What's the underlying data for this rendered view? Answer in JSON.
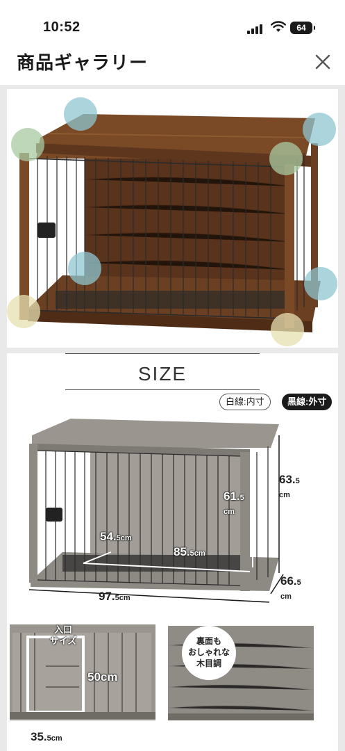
{
  "status_bar": {
    "time": "10:52",
    "battery": "64",
    "icons": [
      "cellular-signal-icon",
      "wifi-icon",
      "battery-icon"
    ]
  },
  "header": {
    "title": "商品ギャラリー",
    "close_icon": "close-icon"
  },
  "gallery": {
    "images": [
      {
        "name": "cage-photo-walnut"
      },
      {
        "name": "cage-size-diagram"
      }
    ]
  },
  "size_diagram": {
    "title": "SIZE",
    "legend_inner": "白線:内寸",
    "legend_outer": "黒線:外寸",
    "height_outer_main": "63.",
    "height_outer_frac": "5",
    "height_outer_unit": "cm",
    "height_inner_main": "61.",
    "height_inner_frac": "5",
    "height_inner_unit": "cm",
    "depth_inner_main": "54.",
    "depth_inner_frac": "5",
    "depth_inner_unit": "cm",
    "width_inner_main": "85.",
    "width_inner_frac": "5",
    "width_inner_unit": "cm",
    "depth_outer_main": "66.",
    "depth_outer_frac": "5",
    "depth_outer_unit": "cm",
    "width_outer_main": "97.",
    "width_outer_frac": "5",
    "width_outer_unit": "cm",
    "entry_label_1": "入口",
    "entry_label_2": "サイズ",
    "entry_height": "50cm",
    "entry_width_main": "35.",
    "entry_width_frac": "5",
    "entry_width_unit": "cm",
    "back_note_1": "裏面も",
    "back_note_2": "おしゃれな",
    "back_note_3": "木目調"
  },
  "colors": {
    "walnut": "#6b3f22",
    "walnut_top": "#7a4a27",
    "gray_wood": "#8d8a84",
    "highlight_circle_blue": "#8fc6d0",
    "highlight_circle_green": "#a9c9a2",
    "highlight_circle_yellow": "#e7e0b0"
  }
}
